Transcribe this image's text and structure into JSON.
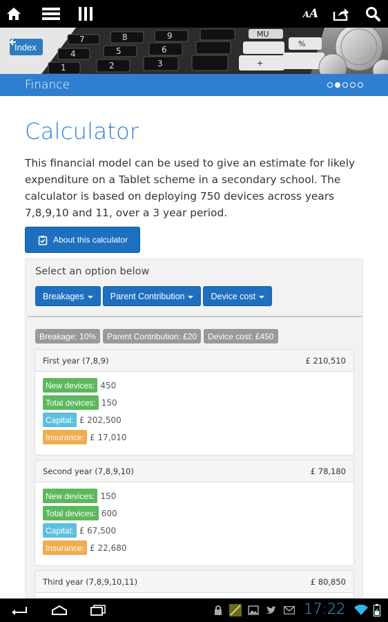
{
  "topbar": {
    "icons": [
      "home-icon",
      "menu-icon",
      "columns-icon",
      "text-size-icon",
      "share-icon",
      "search-icon"
    ]
  },
  "hero": {
    "back_label": "Index",
    "keys": [
      "7",
      "8",
      "9",
      "MU",
      "4",
      "5",
      "6",
      "%",
      "1",
      "2",
      "3",
      "+"
    ]
  },
  "section": {
    "title": "Finance",
    "pager": {
      "total": 5,
      "active": 2
    }
  },
  "main": {
    "title": "Calculator",
    "intro": "This financial model can be used to give an estimate for likely expenditure on a Tablet scheme in a secondary school. The calculator is based on deploying 750 devices across years 7,8,9,10 and 11, over a 3 year period.",
    "about_button": "About this calculator"
  },
  "options": {
    "prompt": "Select an option below",
    "dropdowns": [
      "Breakages",
      "Parent Contribution",
      "Device cost"
    ],
    "tags": [
      "Breakage: 10%",
      "Parent Contribution: £20",
      "Device cost: £450"
    ]
  },
  "years": [
    {
      "title": "First year (7,8,9)",
      "total": "£ 210,510",
      "rows": [
        {
          "label": "New devices:",
          "value": "450",
          "color": "#5cb85c"
        },
        {
          "label": "Total devices:",
          "value": "150",
          "color": "#5cb85c"
        },
        {
          "label": "Capital:",
          "value": "£ 202,500",
          "color": "#5bc0de"
        },
        {
          "label": "Insurance:",
          "value": "£ 17,010",
          "color": "#f0ad4e"
        }
      ]
    },
    {
      "title": "Second year (7,8,9,10)",
      "total": "£ 78,180",
      "rows": [
        {
          "label": "New devices:",
          "value": "150",
          "color": "#5cb85c"
        },
        {
          "label": "Total devices:",
          "value": "600",
          "color": "#5cb85c"
        },
        {
          "label": "Capital:",
          "value": "£ 67,500",
          "color": "#5bc0de"
        },
        {
          "label": "Insurance:",
          "value": "£ 22,680",
          "color": "#f0ad4e"
        }
      ]
    },
    {
      "title": "Third year (7,8,9,10,11)",
      "total": "£ 80,850",
      "rows": []
    }
  ],
  "statusbar": {
    "time": "17:22",
    "icons": [
      "back-icon",
      "home-icon",
      "recent-apps-icon",
      "lock-icon",
      "notification-icon",
      "gallery-icon",
      "twitter-icon",
      "gmail-icon",
      "wifi-icon",
      "battery-icon"
    ]
  },
  "colors": {
    "brand_blue": "#2f7fd0",
    "button_blue": "#1f6fc0",
    "success": "#5cb85c",
    "info": "#5bc0de",
    "warning": "#f0ad4e",
    "clock": "#33b5e5"
  }
}
